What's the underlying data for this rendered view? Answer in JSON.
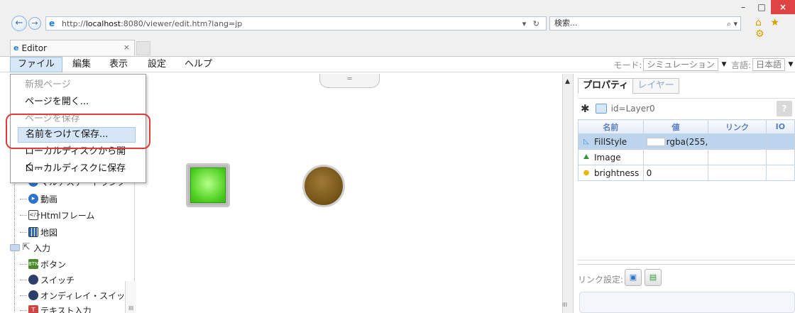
{
  "browser": {
    "url_prefix": "http://",
    "url_host": "localhost",
    "url_rest": ":8080/viewer/edit.htm?lang=jp",
    "addr_tools": "▾ ↻",
    "search_placeholder": "検索...",
    "search_tools": "⌕ ▾",
    "tab_title": "Editor",
    "tab_close": "×",
    "back": "←",
    "forward": "→",
    "win_min": "–",
    "win_max": "□",
    "win_close": "×",
    "right_icons": "⌂ ★ ⚙"
  },
  "menubar": {
    "file": "ファイル",
    "edit": "編集",
    "view": "表示",
    "settings": "設定",
    "help": "ヘルプ",
    "mode_label": "モード:",
    "mode_value": "シミュレーション",
    "lang_label": "言語:",
    "lang_value": "日本語"
  },
  "file_menu": {
    "items": [
      {
        "label": "新規ページ",
        "state": "faded"
      },
      {
        "label": "ページを開く...",
        "state": "normal"
      },
      {
        "label": "ページを保存",
        "state": "faded"
      },
      {
        "label": "名前をつけて保存...",
        "state": "hover"
      },
      {
        "label": "ローカルディスクから開く...",
        "state": "normal"
      },
      {
        "label": "ローカルディスクに保存",
        "state": "normal"
      }
    ]
  },
  "tree": {
    "items": [
      {
        "label": "マルチステートランプ",
        "icon": "multistate-lamp-icon"
      },
      {
        "label": "動画",
        "icon": "video-icon"
      },
      {
        "label": "Htmlフレーム",
        "icon": "html-frame-icon"
      },
      {
        "label": "地図",
        "icon": "map-icon"
      },
      {
        "label": "入力",
        "icon": "cursor-icon"
      },
      {
        "label": "ボタン",
        "icon": "button-icon"
      },
      {
        "label": "スイッチ",
        "icon": "switch-icon"
      },
      {
        "label": "オンディレイ・スイッチ",
        "icon": "ondelay-switch-icon"
      },
      {
        "label": "テキスト入力",
        "icon": "text-input-icon"
      }
    ]
  },
  "canvas": {
    "collapse_handle": "═",
    "scroll_up": "▲",
    "scroll_bottom": "III",
    "left_scroll_mark": "III"
  },
  "properties": {
    "tab_properties": "プロパティ",
    "tab_layers": "レイヤー",
    "id_text": "id=Layer0",
    "help": "?",
    "columns": [
      "名前",
      "値",
      "リンク",
      "IO"
    ],
    "rows": [
      {
        "name": "FillStyle",
        "value": "rgba(255,",
        "link": "",
        "io": "",
        "selected": true,
        "icon": "fillstyle-icon"
      },
      {
        "name": "Image",
        "value": "",
        "link": "",
        "io": "",
        "selected": false,
        "icon": "image-icon"
      },
      {
        "name": "brightness",
        "value": "0",
        "link": "",
        "io": "",
        "selected": false,
        "icon": "brightness-icon"
      }
    ],
    "link_settings_label": "リンク設定:"
  },
  "colors": {
    "accent": "#2a74c9",
    "highlight_border": "#e03a3a",
    "selected_row": "#bdd4ee",
    "green_lamp": "#4fd022",
    "brown_lamp": "#6f4f14"
  }
}
